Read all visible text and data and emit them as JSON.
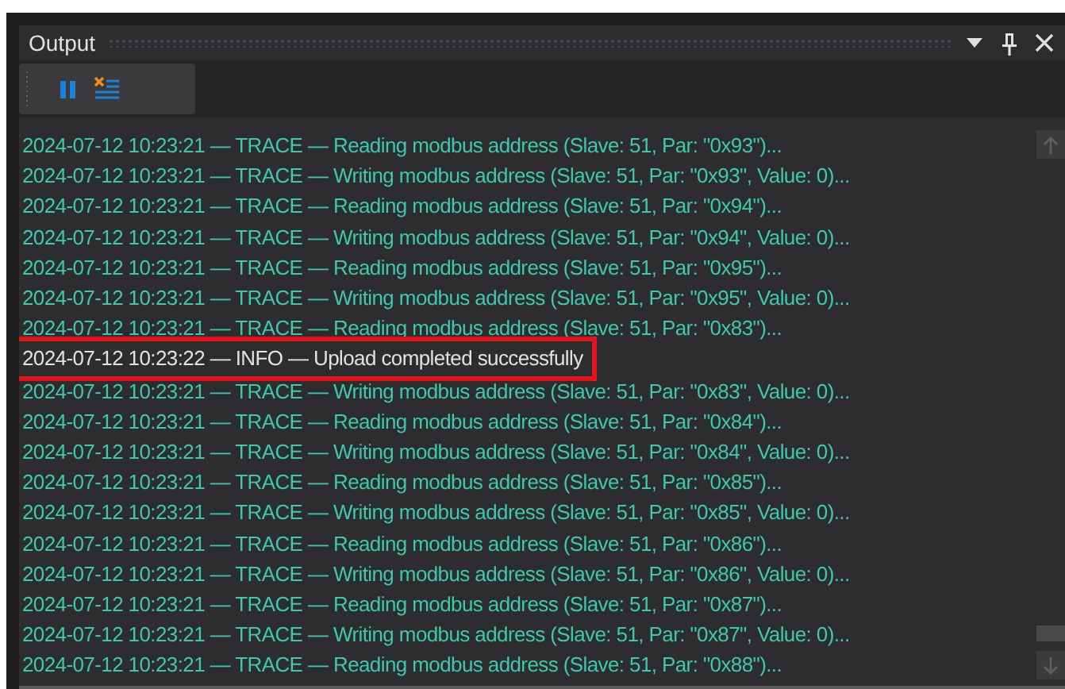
{
  "window": {
    "title": "Output"
  },
  "log_lines": [
    {
      "kind": "trace",
      "text": "2024-07-12 10:23:21 — TRACE — Reading modbus address (Slave: 51, Par: \"0x93\")...",
      "highlighted": false
    },
    {
      "kind": "trace",
      "text": "2024-07-12 10:23:21 — TRACE — Writing modbus address (Slave: 51, Par: \"0x93\", Value: 0)...",
      "highlighted": false
    },
    {
      "kind": "trace",
      "text": "2024-07-12 10:23:21 — TRACE — Reading modbus address (Slave: 51, Par: \"0x94\")...",
      "highlighted": false
    },
    {
      "kind": "trace",
      "text": "2024-07-12 10:23:21 — TRACE — Writing modbus address (Slave: 51, Par: \"0x94\", Value: 0)...",
      "highlighted": false
    },
    {
      "kind": "trace",
      "text": "2024-07-12 10:23:21 — TRACE — Reading modbus address (Slave: 51, Par: \"0x95\")...",
      "highlighted": false
    },
    {
      "kind": "trace",
      "text": "2024-07-12 10:23:21 — TRACE — Writing modbus address (Slave: 51, Par: \"0x95\", Value: 0)...",
      "highlighted": false
    },
    {
      "kind": "trace",
      "text": "2024-07-12 10:23:21 — TRACE — Reading modbus address (Slave: 51, Par: \"0x83\")...",
      "highlighted": false
    },
    {
      "kind": "info",
      "text": "2024-07-12 10:23:22 — INFO — Upload completed successfully",
      "highlighted": true
    },
    {
      "kind": "trace",
      "text": "2024-07-12 10:23:21 — TRACE — Writing modbus address (Slave: 51, Par: \"0x83\", Value: 0)...",
      "highlighted": false
    },
    {
      "kind": "trace",
      "text": "2024-07-12 10:23:21 — TRACE — Reading modbus address (Slave: 51, Par: \"0x84\")...",
      "highlighted": false
    },
    {
      "kind": "trace",
      "text": "2024-07-12 10:23:21 — TRACE — Writing modbus address (Slave: 51, Par: \"0x84\", Value: 0)...",
      "highlighted": false
    },
    {
      "kind": "trace",
      "text": "2024-07-12 10:23:21 — TRACE — Reading modbus address (Slave: 51, Par: \"0x85\")...",
      "highlighted": false
    },
    {
      "kind": "trace",
      "text": "2024-07-12 10:23:21 — TRACE — Writing modbus address (Slave: 51, Par: \"0x85\", Value: 0)...",
      "highlighted": false
    },
    {
      "kind": "trace",
      "text": "2024-07-12 10:23:21 — TRACE — Reading modbus address (Slave: 51, Par: \"0x86\")...",
      "highlighted": false
    },
    {
      "kind": "trace",
      "text": "2024-07-12 10:23:21 — TRACE — Writing modbus address (Slave: 51, Par: \"0x86\", Value: 0)...",
      "highlighted": false
    },
    {
      "kind": "trace",
      "text": "2024-07-12 10:23:21 — TRACE — Reading modbus address (Slave: 51, Par: \"0x87\")...",
      "highlighted": false
    },
    {
      "kind": "trace",
      "text": "2024-07-12 10:23:21 — TRACE — Writing modbus address (Slave: 51, Par: \"0x87\", Value: 0)...",
      "highlighted": false
    },
    {
      "kind": "trace",
      "text": "2024-07-12 10:23:21 — TRACE — Reading modbus address (Slave: 51, Par: \"0x88\")...",
      "highlighted": false
    }
  ]
}
